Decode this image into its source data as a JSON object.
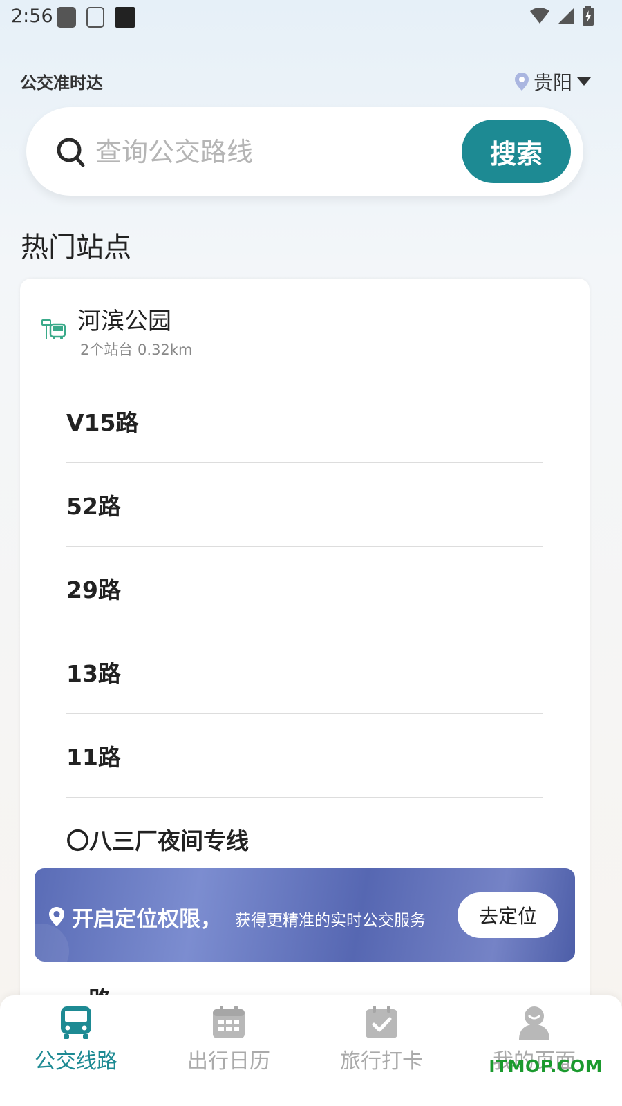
{
  "status_bar": {
    "time": "2:56"
  },
  "header": {
    "app_title": "公交准时达",
    "city": "贵阳"
  },
  "search": {
    "placeholder": "查询公交路线",
    "button_label": "搜索"
  },
  "section": {
    "title": "热门站点"
  },
  "station": {
    "name": "河滨公园",
    "meta": "2个站台 0.32km",
    "routes": [
      "V15路",
      "52路",
      "29路",
      "13路",
      "11路",
      "〇八三厂夜间专线"
    ]
  },
  "location_banner": {
    "main_text": "开启定位权限，",
    "sub_text": "获得更精准的实时公交服务",
    "button_label": "去定位"
  },
  "peek_text": "…路",
  "tabs": [
    {
      "label": "公交线路",
      "active": true
    },
    {
      "label": "出行日历",
      "active": false
    },
    {
      "label": "旅行打卡",
      "active": false
    },
    {
      "label": "我的页面",
      "active": false
    }
  ],
  "watermark": "ITMOP.COM",
  "colors": {
    "accent": "#1d8a93",
    "banner": "#5a6cb6",
    "watermark": "#1b9a2e"
  }
}
